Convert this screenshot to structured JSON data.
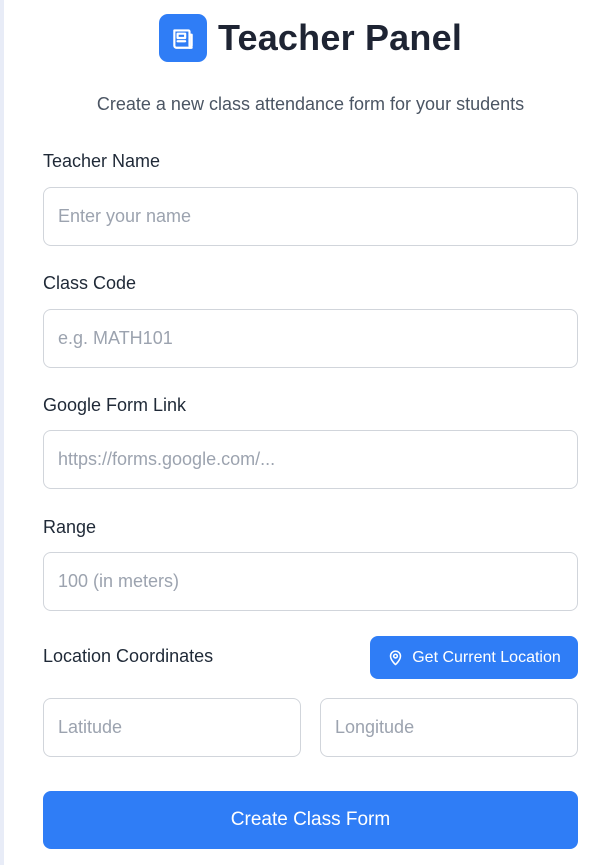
{
  "header": {
    "title": "Teacher Panel",
    "logo_icon": "newspaper-icon",
    "subtitle": "Create a new class attendance form for your students"
  },
  "form": {
    "teacher_name": {
      "label": "Teacher Name",
      "placeholder": "Enter your name",
      "value": ""
    },
    "class_code": {
      "label": "Class Code",
      "placeholder": "e.g. MATH101",
      "value": ""
    },
    "google_form_link": {
      "label": "Google Form Link",
      "placeholder": "https://forms.google.com/...",
      "value": ""
    },
    "range": {
      "label": "Range",
      "placeholder": "100 (in meters)",
      "value": ""
    },
    "location": {
      "label": "Location Coordinates",
      "button_label": "Get Current Location",
      "button_icon": "location-pin-icon",
      "latitude": {
        "placeholder": "Latitude",
        "value": ""
      },
      "longitude": {
        "placeholder": "Longitude",
        "value": ""
      }
    },
    "submit_label": "Create Class Form"
  },
  "colors": {
    "accent": "#2f7df6",
    "border": "#d1d5db",
    "placeholder": "#9ca3af"
  }
}
